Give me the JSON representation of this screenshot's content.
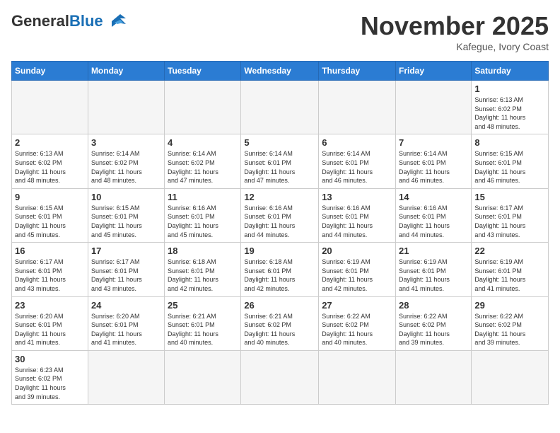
{
  "header": {
    "logo_general": "General",
    "logo_blue": "Blue",
    "month_title": "November 2025",
    "location": "Kafegue, Ivory Coast"
  },
  "weekdays": [
    "Sunday",
    "Monday",
    "Tuesday",
    "Wednesday",
    "Thursday",
    "Friday",
    "Saturday"
  ],
  "weeks": [
    [
      {
        "day": "",
        "info": ""
      },
      {
        "day": "",
        "info": ""
      },
      {
        "day": "",
        "info": ""
      },
      {
        "day": "",
        "info": ""
      },
      {
        "day": "",
        "info": ""
      },
      {
        "day": "",
        "info": ""
      },
      {
        "day": "1",
        "info": "Sunrise: 6:13 AM\nSunset: 6:02 PM\nDaylight: 11 hours\nand 48 minutes."
      }
    ],
    [
      {
        "day": "2",
        "info": "Sunrise: 6:13 AM\nSunset: 6:02 PM\nDaylight: 11 hours\nand 48 minutes."
      },
      {
        "day": "3",
        "info": "Sunrise: 6:14 AM\nSunset: 6:02 PM\nDaylight: 11 hours\nand 48 minutes."
      },
      {
        "day": "4",
        "info": "Sunrise: 6:14 AM\nSunset: 6:02 PM\nDaylight: 11 hours\nand 47 minutes."
      },
      {
        "day": "5",
        "info": "Sunrise: 6:14 AM\nSunset: 6:01 PM\nDaylight: 11 hours\nand 47 minutes."
      },
      {
        "day": "6",
        "info": "Sunrise: 6:14 AM\nSunset: 6:01 PM\nDaylight: 11 hours\nand 46 minutes."
      },
      {
        "day": "7",
        "info": "Sunrise: 6:14 AM\nSunset: 6:01 PM\nDaylight: 11 hours\nand 46 minutes."
      },
      {
        "day": "8",
        "info": "Sunrise: 6:15 AM\nSunset: 6:01 PM\nDaylight: 11 hours\nand 46 minutes."
      }
    ],
    [
      {
        "day": "9",
        "info": "Sunrise: 6:15 AM\nSunset: 6:01 PM\nDaylight: 11 hours\nand 45 minutes."
      },
      {
        "day": "10",
        "info": "Sunrise: 6:15 AM\nSunset: 6:01 PM\nDaylight: 11 hours\nand 45 minutes."
      },
      {
        "day": "11",
        "info": "Sunrise: 6:16 AM\nSunset: 6:01 PM\nDaylight: 11 hours\nand 45 minutes."
      },
      {
        "day": "12",
        "info": "Sunrise: 6:16 AM\nSunset: 6:01 PM\nDaylight: 11 hours\nand 44 minutes."
      },
      {
        "day": "13",
        "info": "Sunrise: 6:16 AM\nSunset: 6:01 PM\nDaylight: 11 hours\nand 44 minutes."
      },
      {
        "day": "14",
        "info": "Sunrise: 6:16 AM\nSunset: 6:01 PM\nDaylight: 11 hours\nand 44 minutes."
      },
      {
        "day": "15",
        "info": "Sunrise: 6:17 AM\nSunset: 6:01 PM\nDaylight: 11 hours\nand 43 minutes."
      }
    ],
    [
      {
        "day": "16",
        "info": "Sunrise: 6:17 AM\nSunset: 6:01 PM\nDaylight: 11 hours\nand 43 minutes."
      },
      {
        "day": "17",
        "info": "Sunrise: 6:17 AM\nSunset: 6:01 PM\nDaylight: 11 hours\nand 43 minutes."
      },
      {
        "day": "18",
        "info": "Sunrise: 6:18 AM\nSunset: 6:01 PM\nDaylight: 11 hours\nand 42 minutes."
      },
      {
        "day": "19",
        "info": "Sunrise: 6:18 AM\nSunset: 6:01 PM\nDaylight: 11 hours\nand 42 minutes."
      },
      {
        "day": "20",
        "info": "Sunrise: 6:19 AM\nSunset: 6:01 PM\nDaylight: 11 hours\nand 42 minutes."
      },
      {
        "day": "21",
        "info": "Sunrise: 6:19 AM\nSunset: 6:01 PM\nDaylight: 11 hours\nand 41 minutes."
      },
      {
        "day": "22",
        "info": "Sunrise: 6:19 AM\nSunset: 6:01 PM\nDaylight: 11 hours\nand 41 minutes."
      }
    ],
    [
      {
        "day": "23",
        "info": "Sunrise: 6:20 AM\nSunset: 6:01 PM\nDaylight: 11 hours\nand 41 minutes."
      },
      {
        "day": "24",
        "info": "Sunrise: 6:20 AM\nSunset: 6:01 PM\nDaylight: 11 hours\nand 41 minutes."
      },
      {
        "day": "25",
        "info": "Sunrise: 6:21 AM\nSunset: 6:01 PM\nDaylight: 11 hours\nand 40 minutes."
      },
      {
        "day": "26",
        "info": "Sunrise: 6:21 AM\nSunset: 6:02 PM\nDaylight: 11 hours\nand 40 minutes."
      },
      {
        "day": "27",
        "info": "Sunrise: 6:22 AM\nSunset: 6:02 PM\nDaylight: 11 hours\nand 40 minutes."
      },
      {
        "day": "28",
        "info": "Sunrise: 6:22 AM\nSunset: 6:02 PM\nDaylight: 11 hours\nand 39 minutes."
      },
      {
        "day": "29",
        "info": "Sunrise: 6:22 AM\nSunset: 6:02 PM\nDaylight: 11 hours\nand 39 minutes."
      }
    ],
    [
      {
        "day": "30",
        "info": "Sunrise: 6:23 AM\nSunset: 6:02 PM\nDaylight: 11 hours\nand 39 minutes."
      },
      {
        "day": "",
        "info": ""
      },
      {
        "day": "",
        "info": ""
      },
      {
        "day": "",
        "info": ""
      },
      {
        "day": "",
        "info": ""
      },
      {
        "day": "",
        "info": ""
      },
      {
        "day": "",
        "info": ""
      }
    ]
  ]
}
